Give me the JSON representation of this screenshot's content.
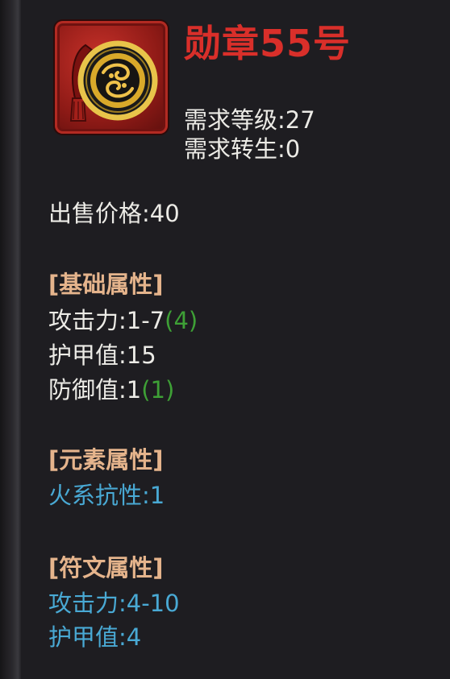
{
  "item": {
    "name": "勋章55号",
    "icon": "medal-icon",
    "req_level": "需求等级:27",
    "req_rebirth": "需求转生:0",
    "sell_price": "出售价格:40"
  },
  "basic": {
    "header": "[基础属性]",
    "attack_label": "攻击力:1-7",
    "attack_bonus": "(4)",
    "armor_label": "护甲值:15",
    "defense_label": "防御值:1",
    "defense_bonus": "(1)"
  },
  "element": {
    "header": "[元素属性]",
    "fire_res": "火系抗性:1"
  },
  "rune": {
    "header": "[符文属性]",
    "attack": "攻击力:4-10",
    "armor": "护甲值:4"
  },
  "colors": {
    "background": "#1e1d21",
    "title": "#d92f2a",
    "header": "#e5b48c",
    "text": "#ecebe6",
    "bonus": "#3ea036",
    "elemental": "#49a9d4"
  }
}
